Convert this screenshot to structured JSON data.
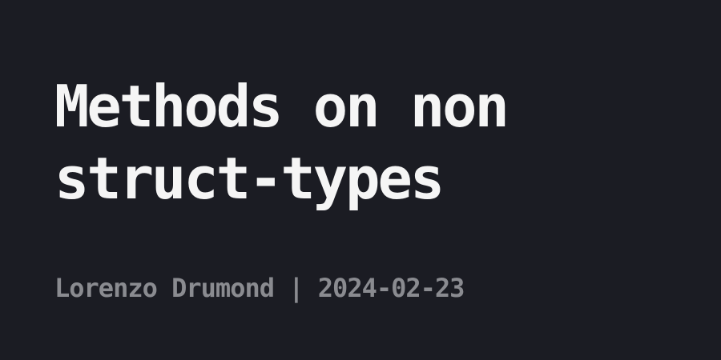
{
  "post": {
    "title": "Methods on non\nstruct-types",
    "author": "Lorenzo Drumond",
    "separator": " | ",
    "date": "2024-02-23"
  },
  "colors": {
    "background": "#1b1c23",
    "title": "#f5f5f5",
    "meta": "#8a8b90"
  }
}
